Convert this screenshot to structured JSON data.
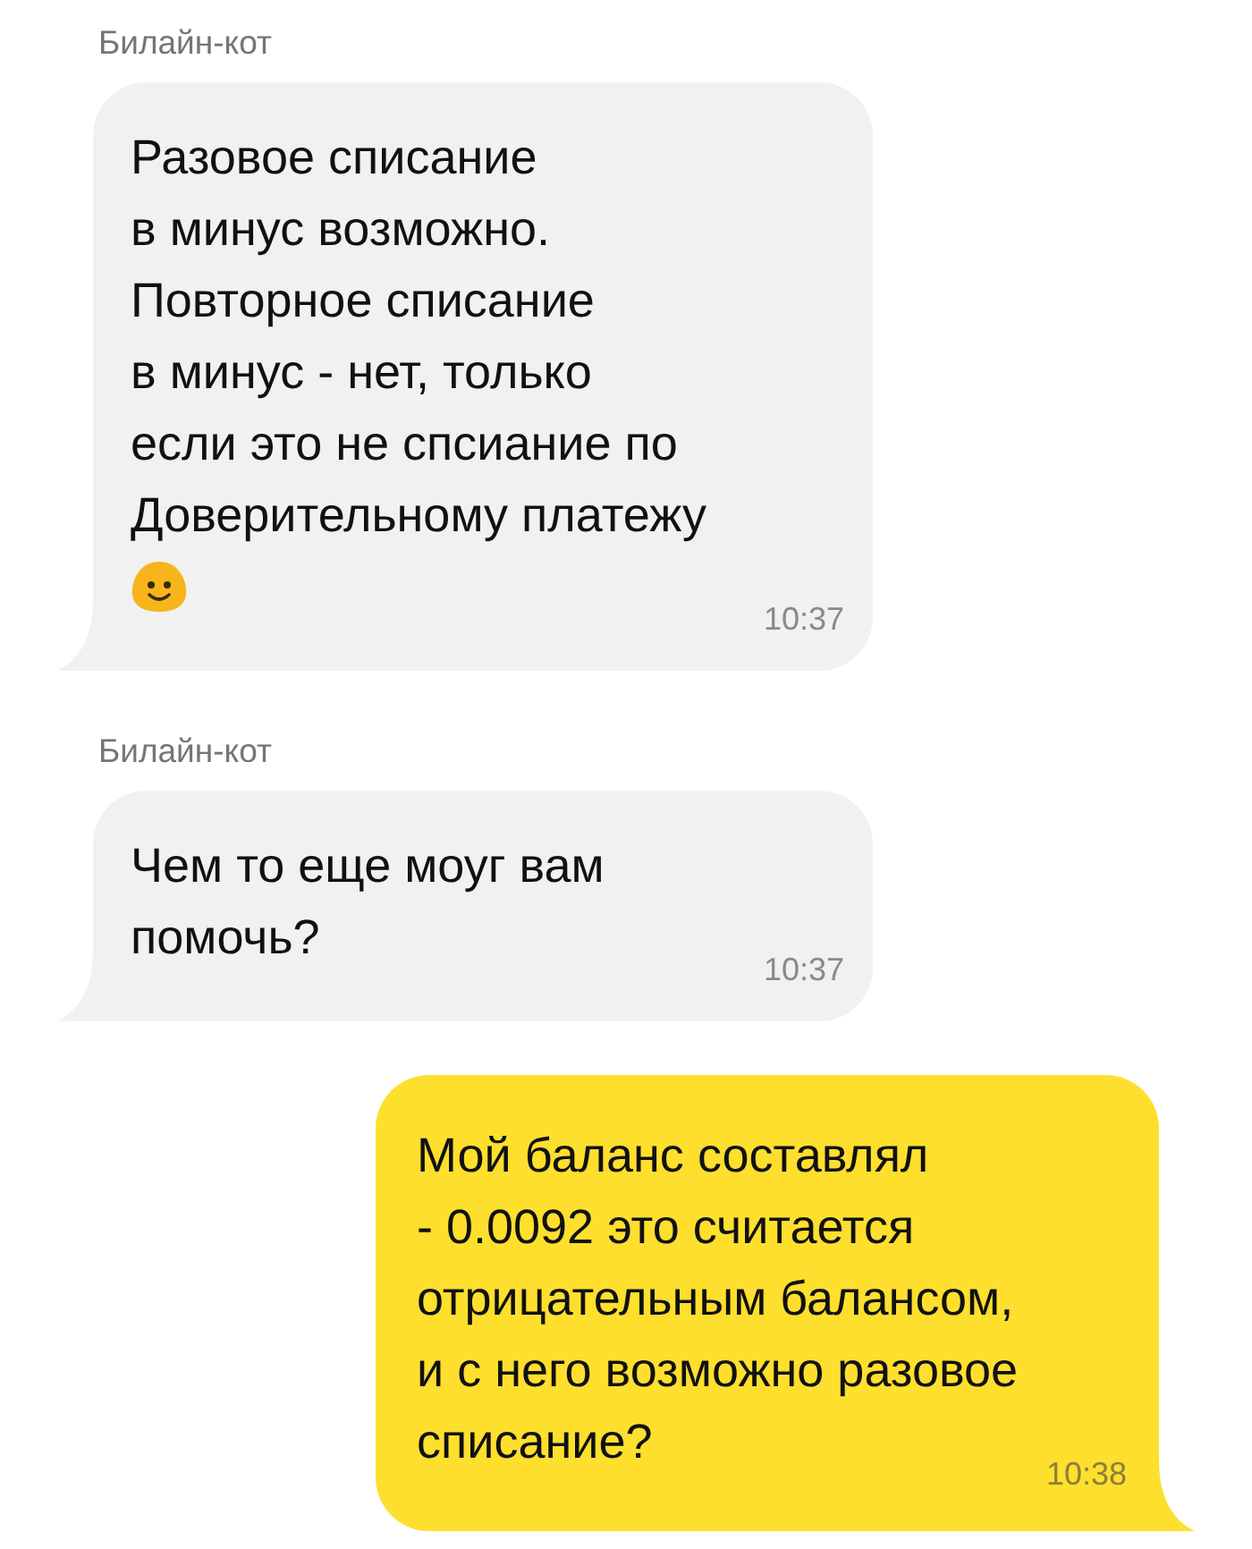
{
  "messages": [
    {
      "kind": "incoming",
      "sender": "Билайн-кот",
      "text": "Разовое списание\nв минус возможно.\nПовторное списание\nв минус - нет, только\nесли это не спсиание по\nДоверительному платежу",
      "smiley": true,
      "time": "10:37"
    },
    {
      "kind": "incoming",
      "sender": "Билайн-кот",
      "text": "Чем то еще моуг вам\nпомочь?",
      "time": "10:37"
    },
    {
      "kind": "outgoing",
      "text": "Мой баланс составлял\n- 0.0092 это считается\nотрицательным балансом,\nи с него возможно разовое\nсписание?",
      "time": "10:38"
    }
  ]
}
